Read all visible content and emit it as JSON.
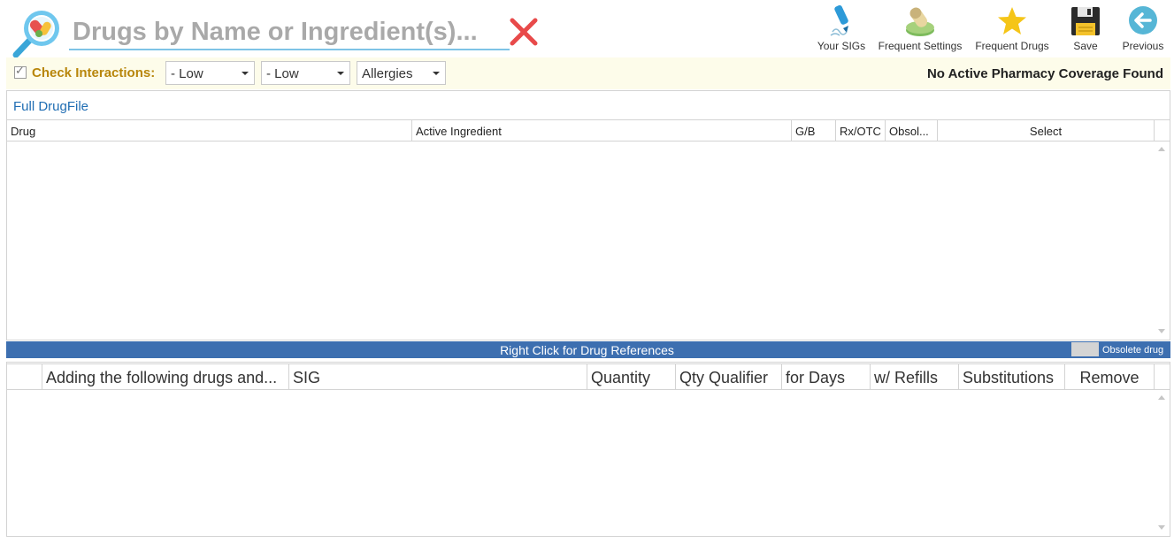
{
  "search": {
    "placeholder": "Drugs by Name or Ingredient(s)...",
    "value": ""
  },
  "toolbar": {
    "your_sigs": "Your SIGs",
    "frequent_settings": "Frequent Settings",
    "frequent_drugs": "Frequent Drugs",
    "save": "Save",
    "previous": "Previous"
  },
  "interactions": {
    "checked": true,
    "label": "Check Interactions:",
    "severity1": "- Low",
    "severity2": "- Low",
    "allergies": "Allergies",
    "coverage": "No Active Pharmacy Coverage Found"
  },
  "drug_grid": {
    "link": "Full DrugFile",
    "columns": [
      "Drug",
      "Active Ingredient",
      "G/B",
      "Rx/OTC",
      "Obsol...",
      "Select"
    ],
    "rows": []
  },
  "status": {
    "text": "Right Click for Drug References",
    "legend": "Obsolete drug"
  },
  "orders_grid": {
    "columns": [
      "",
      "Adding the following drugs and...",
      "SIG",
      "Quantity",
      "Qty Qualifier",
      "for Days",
      "w/ Refills",
      "Substitutions",
      "Remove"
    ],
    "rows": []
  },
  "colors": {
    "accent": "#3d6fb0",
    "link": "#1f6db3",
    "interaction_label": "#b8860b",
    "clear": "#e84a4a"
  },
  "icons": [
    "magnifier-pills-icon",
    "clear-x-icon",
    "pen-icon",
    "pills-icon",
    "star-icon",
    "floppy-disk-icon",
    "back-arrow-icon"
  ]
}
